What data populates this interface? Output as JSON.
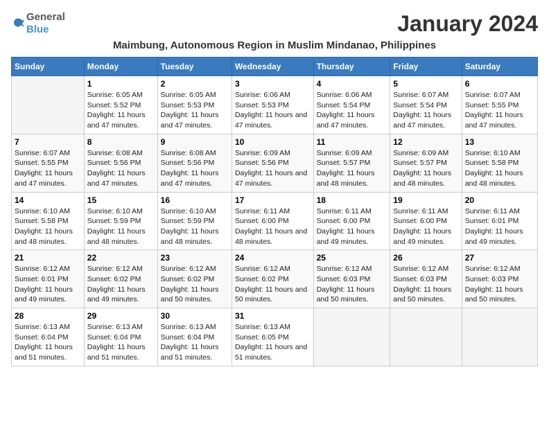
{
  "header": {
    "logo_general": "General",
    "logo_blue": "Blue",
    "month_title": "January 2024",
    "location": "Maimbung, Autonomous Region in Muslim Mindanao, Philippines"
  },
  "weekdays": [
    "Sunday",
    "Monday",
    "Tuesday",
    "Wednesday",
    "Thursday",
    "Friday",
    "Saturday"
  ],
  "weeks": [
    [
      {
        "day": "",
        "sunrise": "",
        "sunset": "",
        "daylight": ""
      },
      {
        "day": "1",
        "sunrise": "Sunrise: 6:05 AM",
        "sunset": "Sunset: 5:52 PM",
        "daylight": "Daylight: 11 hours and 47 minutes."
      },
      {
        "day": "2",
        "sunrise": "Sunrise: 6:05 AM",
        "sunset": "Sunset: 5:53 PM",
        "daylight": "Daylight: 11 hours and 47 minutes."
      },
      {
        "day": "3",
        "sunrise": "Sunrise: 6:06 AM",
        "sunset": "Sunset: 5:53 PM",
        "daylight": "Daylight: 11 hours and 47 minutes."
      },
      {
        "day": "4",
        "sunrise": "Sunrise: 6:06 AM",
        "sunset": "Sunset: 5:54 PM",
        "daylight": "Daylight: 11 hours and 47 minutes."
      },
      {
        "day": "5",
        "sunrise": "Sunrise: 6:07 AM",
        "sunset": "Sunset: 5:54 PM",
        "daylight": "Daylight: 11 hours and 47 minutes."
      },
      {
        "day": "6",
        "sunrise": "Sunrise: 6:07 AM",
        "sunset": "Sunset: 5:55 PM",
        "daylight": "Daylight: 11 hours and 47 minutes."
      }
    ],
    [
      {
        "day": "7",
        "sunrise": "Sunrise: 6:07 AM",
        "sunset": "Sunset: 5:55 PM",
        "daylight": "Daylight: 11 hours and 47 minutes."
      },
      {
        "day": "8",
        "sunrise": "Sunrise: 6:08 AM",
        "sunset": "Sunset: 5:56 PM",
        "daylight": "Daylight: 11 hours and 47 minutes."
      },
      {
        "day": "9",
        "sunrise": "Sunrise: 6:08 AM",
        "sunset": "Sunset: 5:56 PM",
        "daylight": "Daylight: 11 hours and 47 minutes."
      },
      {
        "day": "10",
        "sunrise": "Sunrise: 6:09 AM",
        "sunset": "Sunset: 5:56 PM",
        "daylight": "Daylight: 11 hours and 47 minutes."
      },
      {
        "day": "11",
        "sunrise": "Sunrise: 6:09 AM",
        "sunset": "Sunset: 5:57 PM",
        "daylight": "Daylight: 11 hours and 48 minutes."
      },
      {
        "day": "12",
        "sunrise": "Sunrise: 6:09 AM",
        "sunset": "Sunset: 5:57 PM",
        "daylight": "Daylight: 11 hours and 48 minutes."
      },
      {
        "day": "13",
        "sunrise": "Sunrise: 6:10 AM",
        "sunset": "Sunset: 5:58 PM",
        "daylight": "Daylight: 11 hours and 48 minutes."
      }
    ],
    [
      {
        "day": "14",
        "sunrise": "Sunrise: 6:10 AM",
        "sunset": "Sunset: 5:58 PM",
        "daylight": "Daylight: 11 hours and 48 minutes."
      },
      {
        "day": "15",
        "sunrise": "Sunrise: 6:10 AM",
        "sunset": "Sunset: 5:59 PM",
        "daylight": "Daylight: 11 hours and 48 minutes."
      },
      {
        "day": "16",
        "sunrise": "Sunrise: 6:10 AM",
        "sunset": "Sunset: 5:59 PM",
        "daylight": "Daylight: 11 hours and 48 minutes."
      },
      {
        "day": "17",
        "sunrise": "Sunrise: 6:11 AM",
        "sunset": "Sunset: 6:00 PM",
        "daylight": "Daylight: 11 hours and 48 minutes."
      },
      {
        "day": "18",
        "sunrise": "Sunrise: 6:11 AM",
        "sunset": "Sunset: 6:00 PM",
        "daylight": "Daylight: 11 hours and 49 minutes."
      },
      {
        "day": "19",
        "sunrise": "Sunrise: 6:11 AM",
        "sunset": "Sunset: 6:00 PM",
        "daylight": "Daylight: 11 hours and 49 minutes."
      },
      {
        "day": "20",
        "sunrise": "Sunrise: 6:11 AM",
        "sunset": "Sunset: 6:01 PM",
        "daylight": "Daylight: 11 hours and 49 minutes."
      }
    ],
    [
      {
        "day": "21",
        "sunrise": "Sunrise: 6:12 AM",
        "sunset": "Sunset: 6:01 PM",
        "daylight": "Daylight: 11 hours and 49 minutes."
      },
      {
        "day": "22",
        "sunrise": "Sunrise: 6:12 AM",
        "sunset": "Sunset: 6:02 PM",
        "daylight": "Daylight: 11 hours and 49 minutes."
      },
      {
        "day": "23",
        "sunrise": "Sunrise: 6:12 AM",
        "sunset": "Sunset: 6:02 PM",
        "daylight": "Daylight: 11 hours and 50 minutes."
      },
      {
        "day": "24",
        "sunrise": "Sunrise: 6:12 AM",
        "sunset": "Sunset: 6:02 PM",
        "daylight": "Daylight: 11 hours and 50 minutes."
      },
      {
        "day": "25",
        "sunrise": "Sunrise: 6:12 AM",
        "sunset": "Sunset: 6:03 PM",
        "daylight": "Daylight: 11 hours and 50 minutes."
      },
      {
        "day": "26",
        "sunrise": "Sunrise: 6:12 AM",
        "sunset": "Sunset: 6:03 PM",
        "daylight": "Daylight: 11 hours and 50 minutes."
      },
      {
        "day": "27",
        "sunrise": "Sunrise: 6:12 AM",
        "sunset": "Sunset: 6:03 PM",
        "daylight": "Daylight: 11 hours and 50 minutes."
      }
    ],
    [
      {
        "day": "28",
        "sunrise": "Sunrise: 6:13 AM",
        "sunset": "Sunset: 6:04 PM",
        "daylight": "Daylight: 11 hours and 51 minutes."
      },
      {
        "day": "29",
        "sunrise": "Sunrise: 6:13 AM",
        "sunset": "Sunset: 6:04 PM",
        "daylight": "Daylight: 11 hours and 51 minutes."
      },
      {
        "day": "30",
        "sunrise": "Sunrise: 6:13 AM",
        "sunset": "Sunset: 6:04 PM",
        "daylight": "Daylight: 11 hours and 51 minutes."
      },
      {
        "day": "31",
        "sunrise": "Sunrise: 6:13 AM",
        "sunset": "Sunset: 6:05 PM",
        "daylight": "Daylight: 11 hours and 51 minutes."
      },
      {
        "day": "",
        "sunrise": "",
        "sunset": "",
        "daylight": ""
      },
      {
        "day": "",
        "sunrise": "",
        "sunset": "",
        "daylight": ""
      },
      {
        "day": "",
        "sunrise": "",
        "sunset": "",
        "daylight": ""
      }
    ]
  ]
}
